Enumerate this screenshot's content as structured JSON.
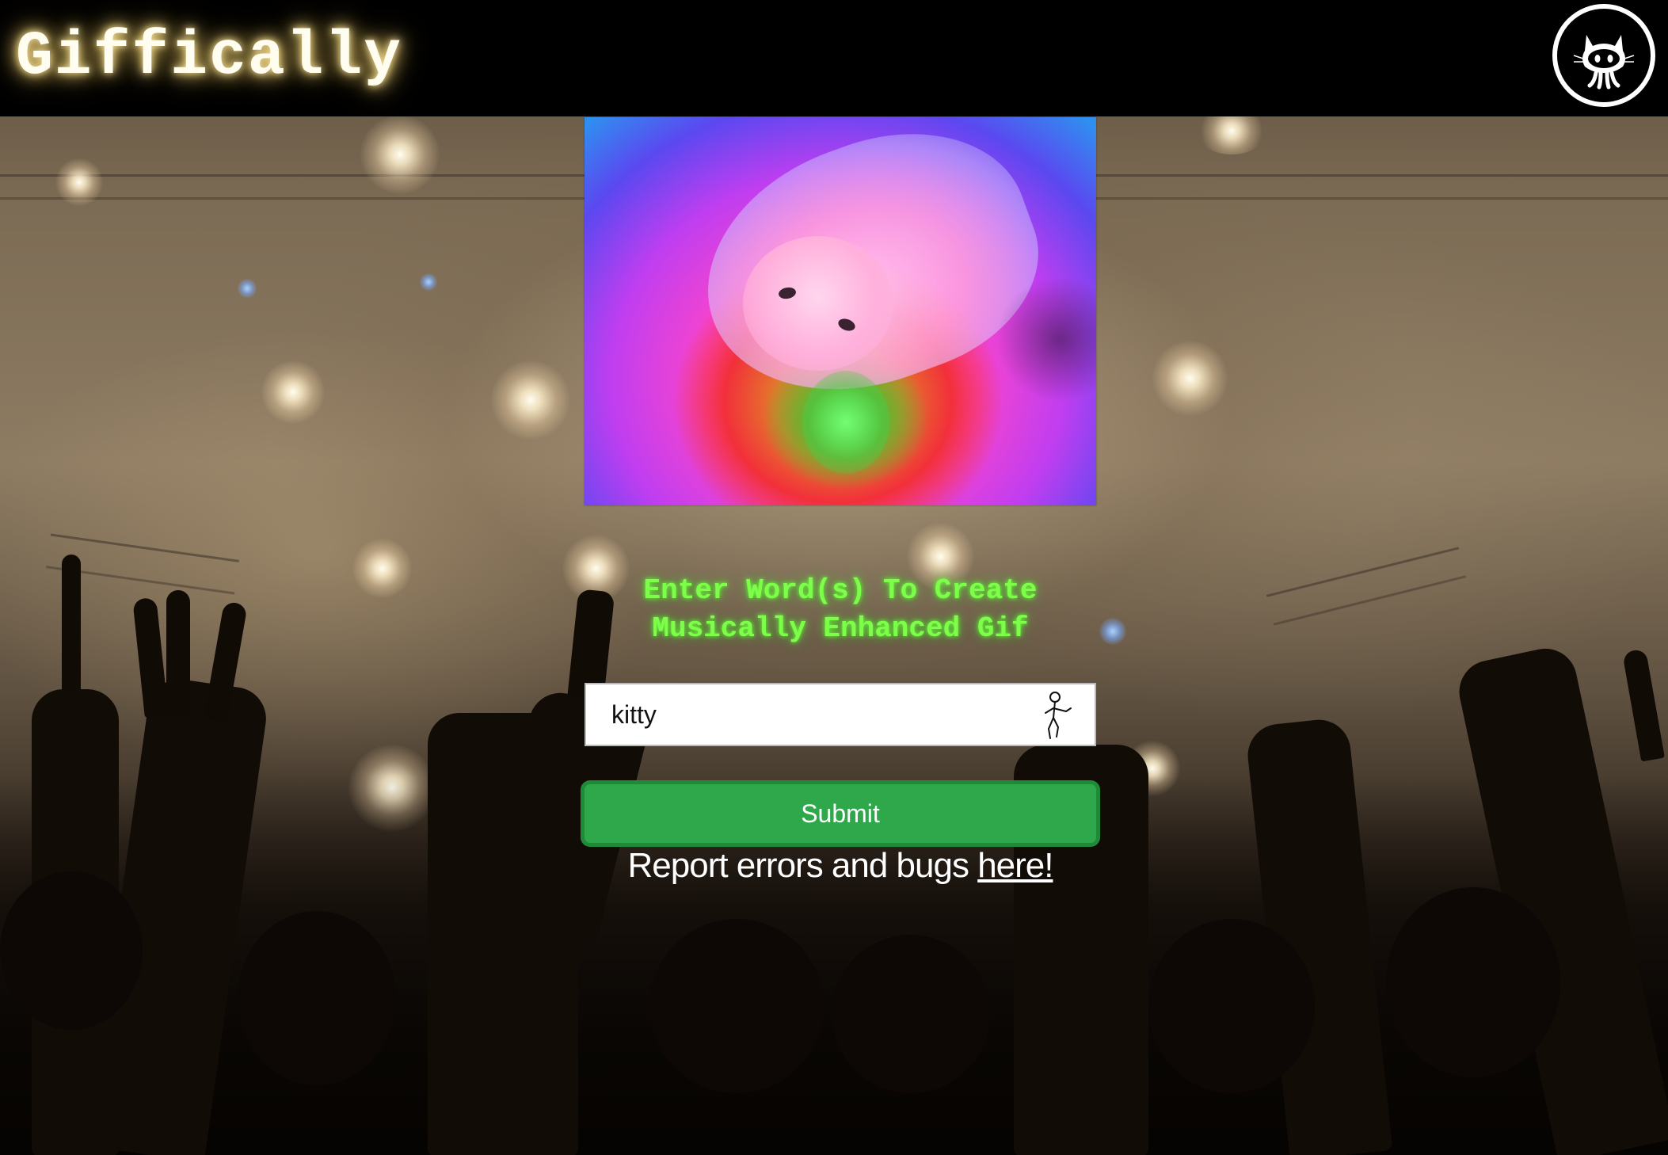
{
  "header": {
    "brand": "Giffically",
    "github_icon": "github-octocat-icon"
  },
  "gif": {
    "description_icon": "gif-image"
  },
  "prompt": {
    "line1": "Enter Word(s) To Create",
    "line2": "Musically Enhanced Gif"
  },
  "search": {
    "value": "kitty",
    "placeholder": "",
    "icon": "dancing-stickman-icon"
  },
  "submit": {
    "label": "Submit"
  },
  "report": {
    "text": "Report errors and bugs ",
    "link_label": "here!"
  },
  "colors": {
    "header_bg": "#000000",
    "brand_glow": "#f7d777",
    "prompt_green": "#7dff4a",
    "submit_green": "#2ea84b"
  }
}
